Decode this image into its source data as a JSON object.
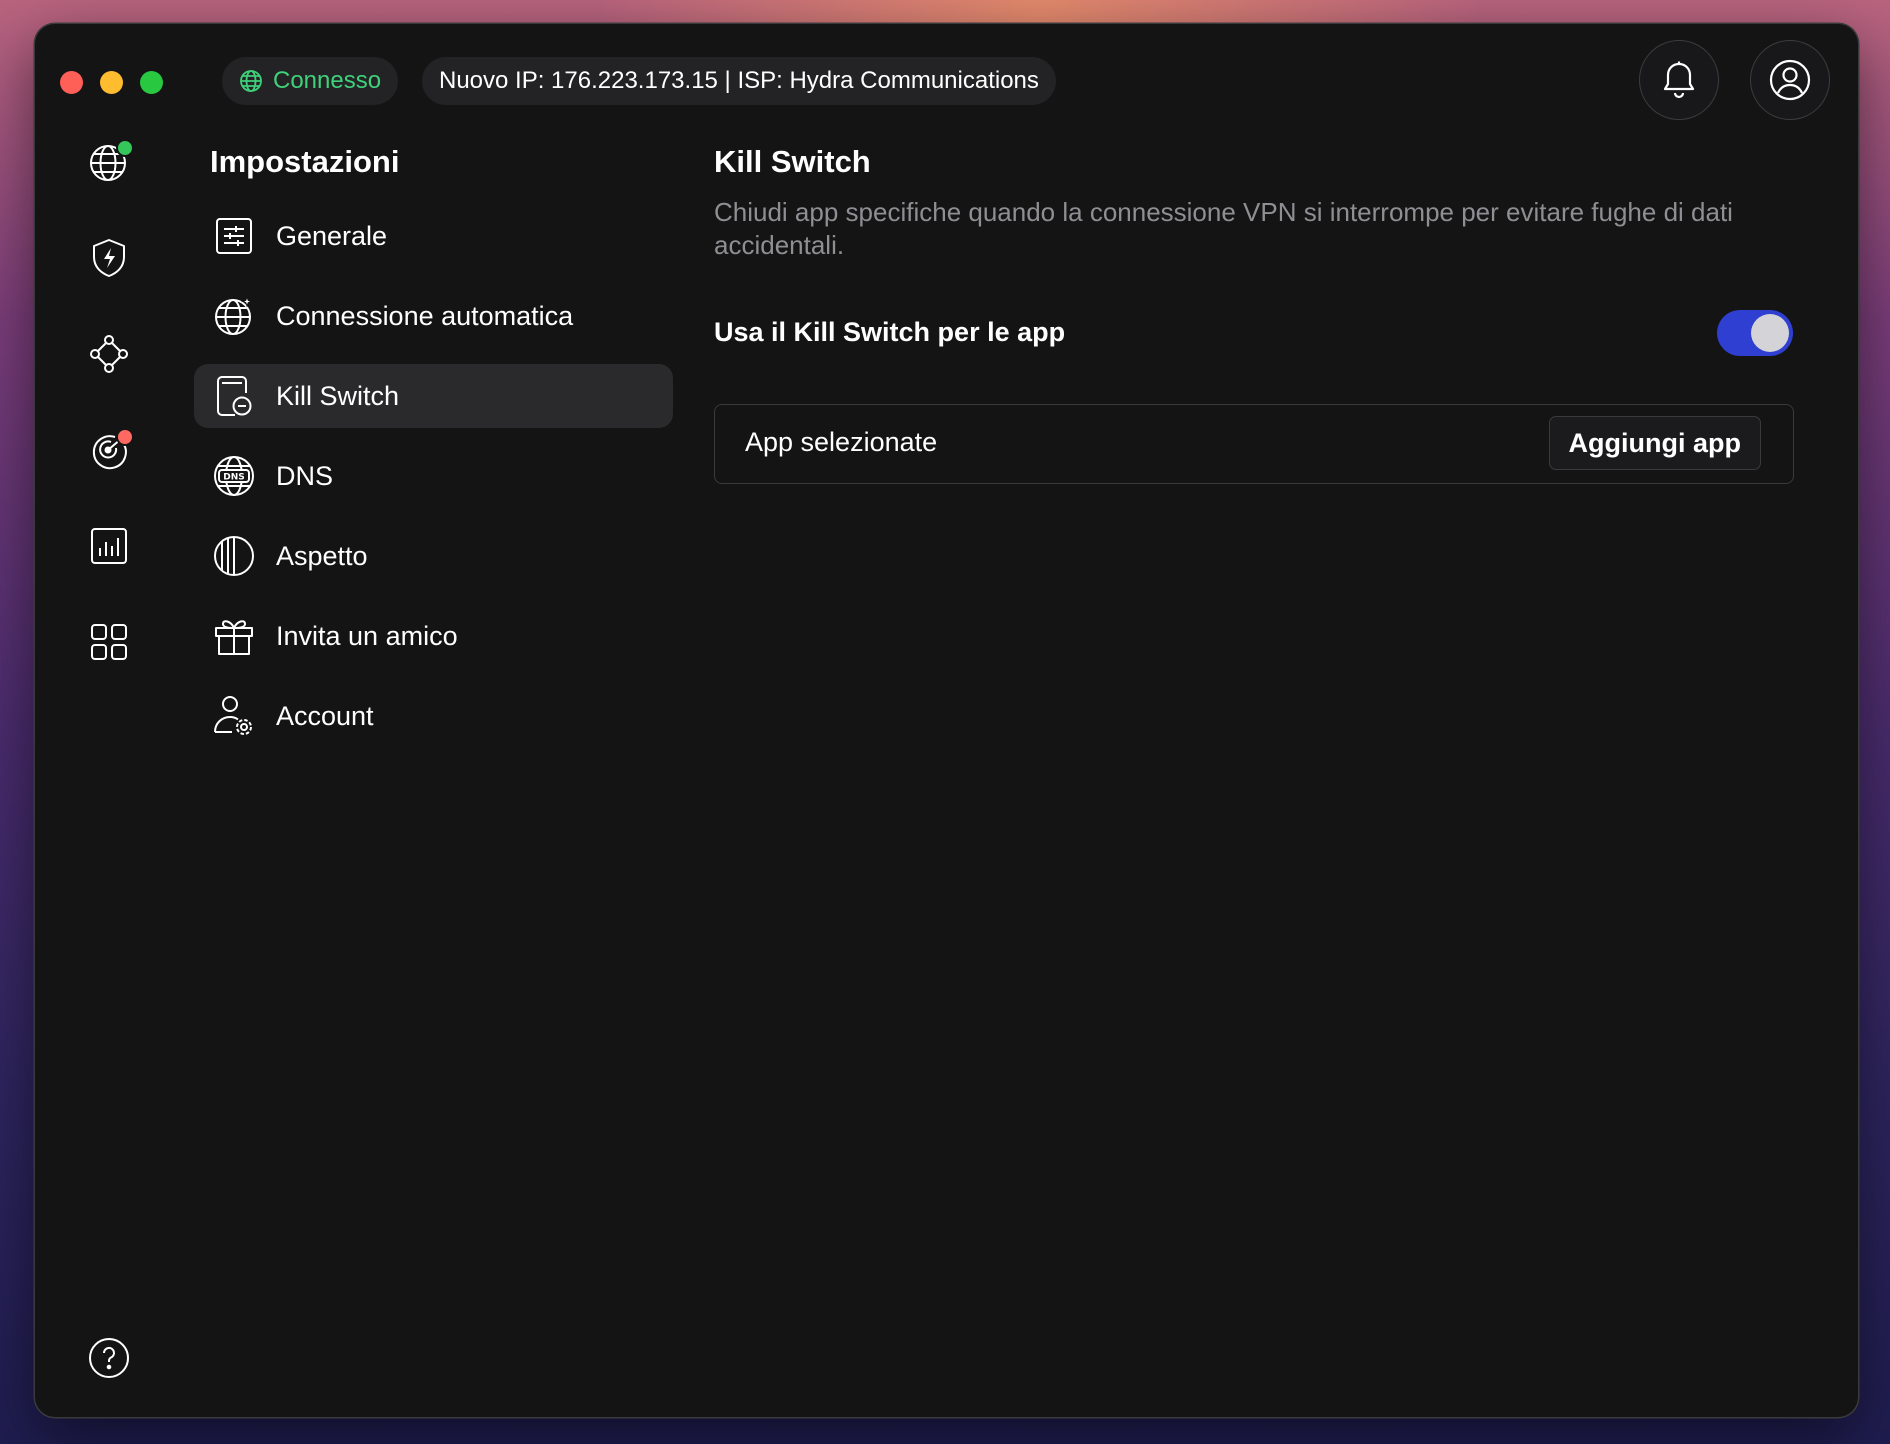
{
  "titlebar": {
    "status_label": "Connesso",
    "ip_info": "Nuovo IP: 176.223.173.15 | ISP: Hydra Communications",
    "status_color": "#3fd07a"
  },
  "rail": {
    "items": [
      {
        "name": "globe-icon",
        "badge_color": "#34c759"
      },
      {
        "name": "shield-bolt-icon"
      },
      {
        "name": "network-nodes-icon"
      },
      {
        "name": "radar-icon",
        "badge_color": "#ff6961"
      },
      {
        "name": "chart-icon"
      },
      {
        "name": "apps-grid-icon"
      }
    ],
    "help": "help-icon"
  },
  "settings": {
    "title": "Impostazioni",
    "items": [
      {
        "label": "Generale",
        "icon": "sliders-icon"
      },
      {
        "label": "Connessione automatica",
        "icon": "globe-sparkle-icon"
      },
      {
        "label": "Kill Switch",
        "icon": "kill-switch-icon",
        "active": true
      },
      {
        "label": "DNS",
        "icon": "dns-globe-icon"
      },
      {
        "label": "Aspetto",
        "icon": "appearance-icon"
      },
      {
        "label": "Invita un amico",
        "icon": "gift-icon"
      },
      {
        "label": "Account",
        "icon": "user-gear-icon"
      }
    ]
  },
  "panel": {
    "title": "Kill Switch",
    "description": "Chiudi app specifiche quando la connessione VPN si interrompe per evitare fughe di dati accidentali.",
    "toggle_label": "Usa il Kill Switch per le app",
    "toggle_on": true,
    "toggle_color": "#2f3fd1",
    "apps_label": "App selezionate",
    "add_button": "Aggiungi app"
  }
}
